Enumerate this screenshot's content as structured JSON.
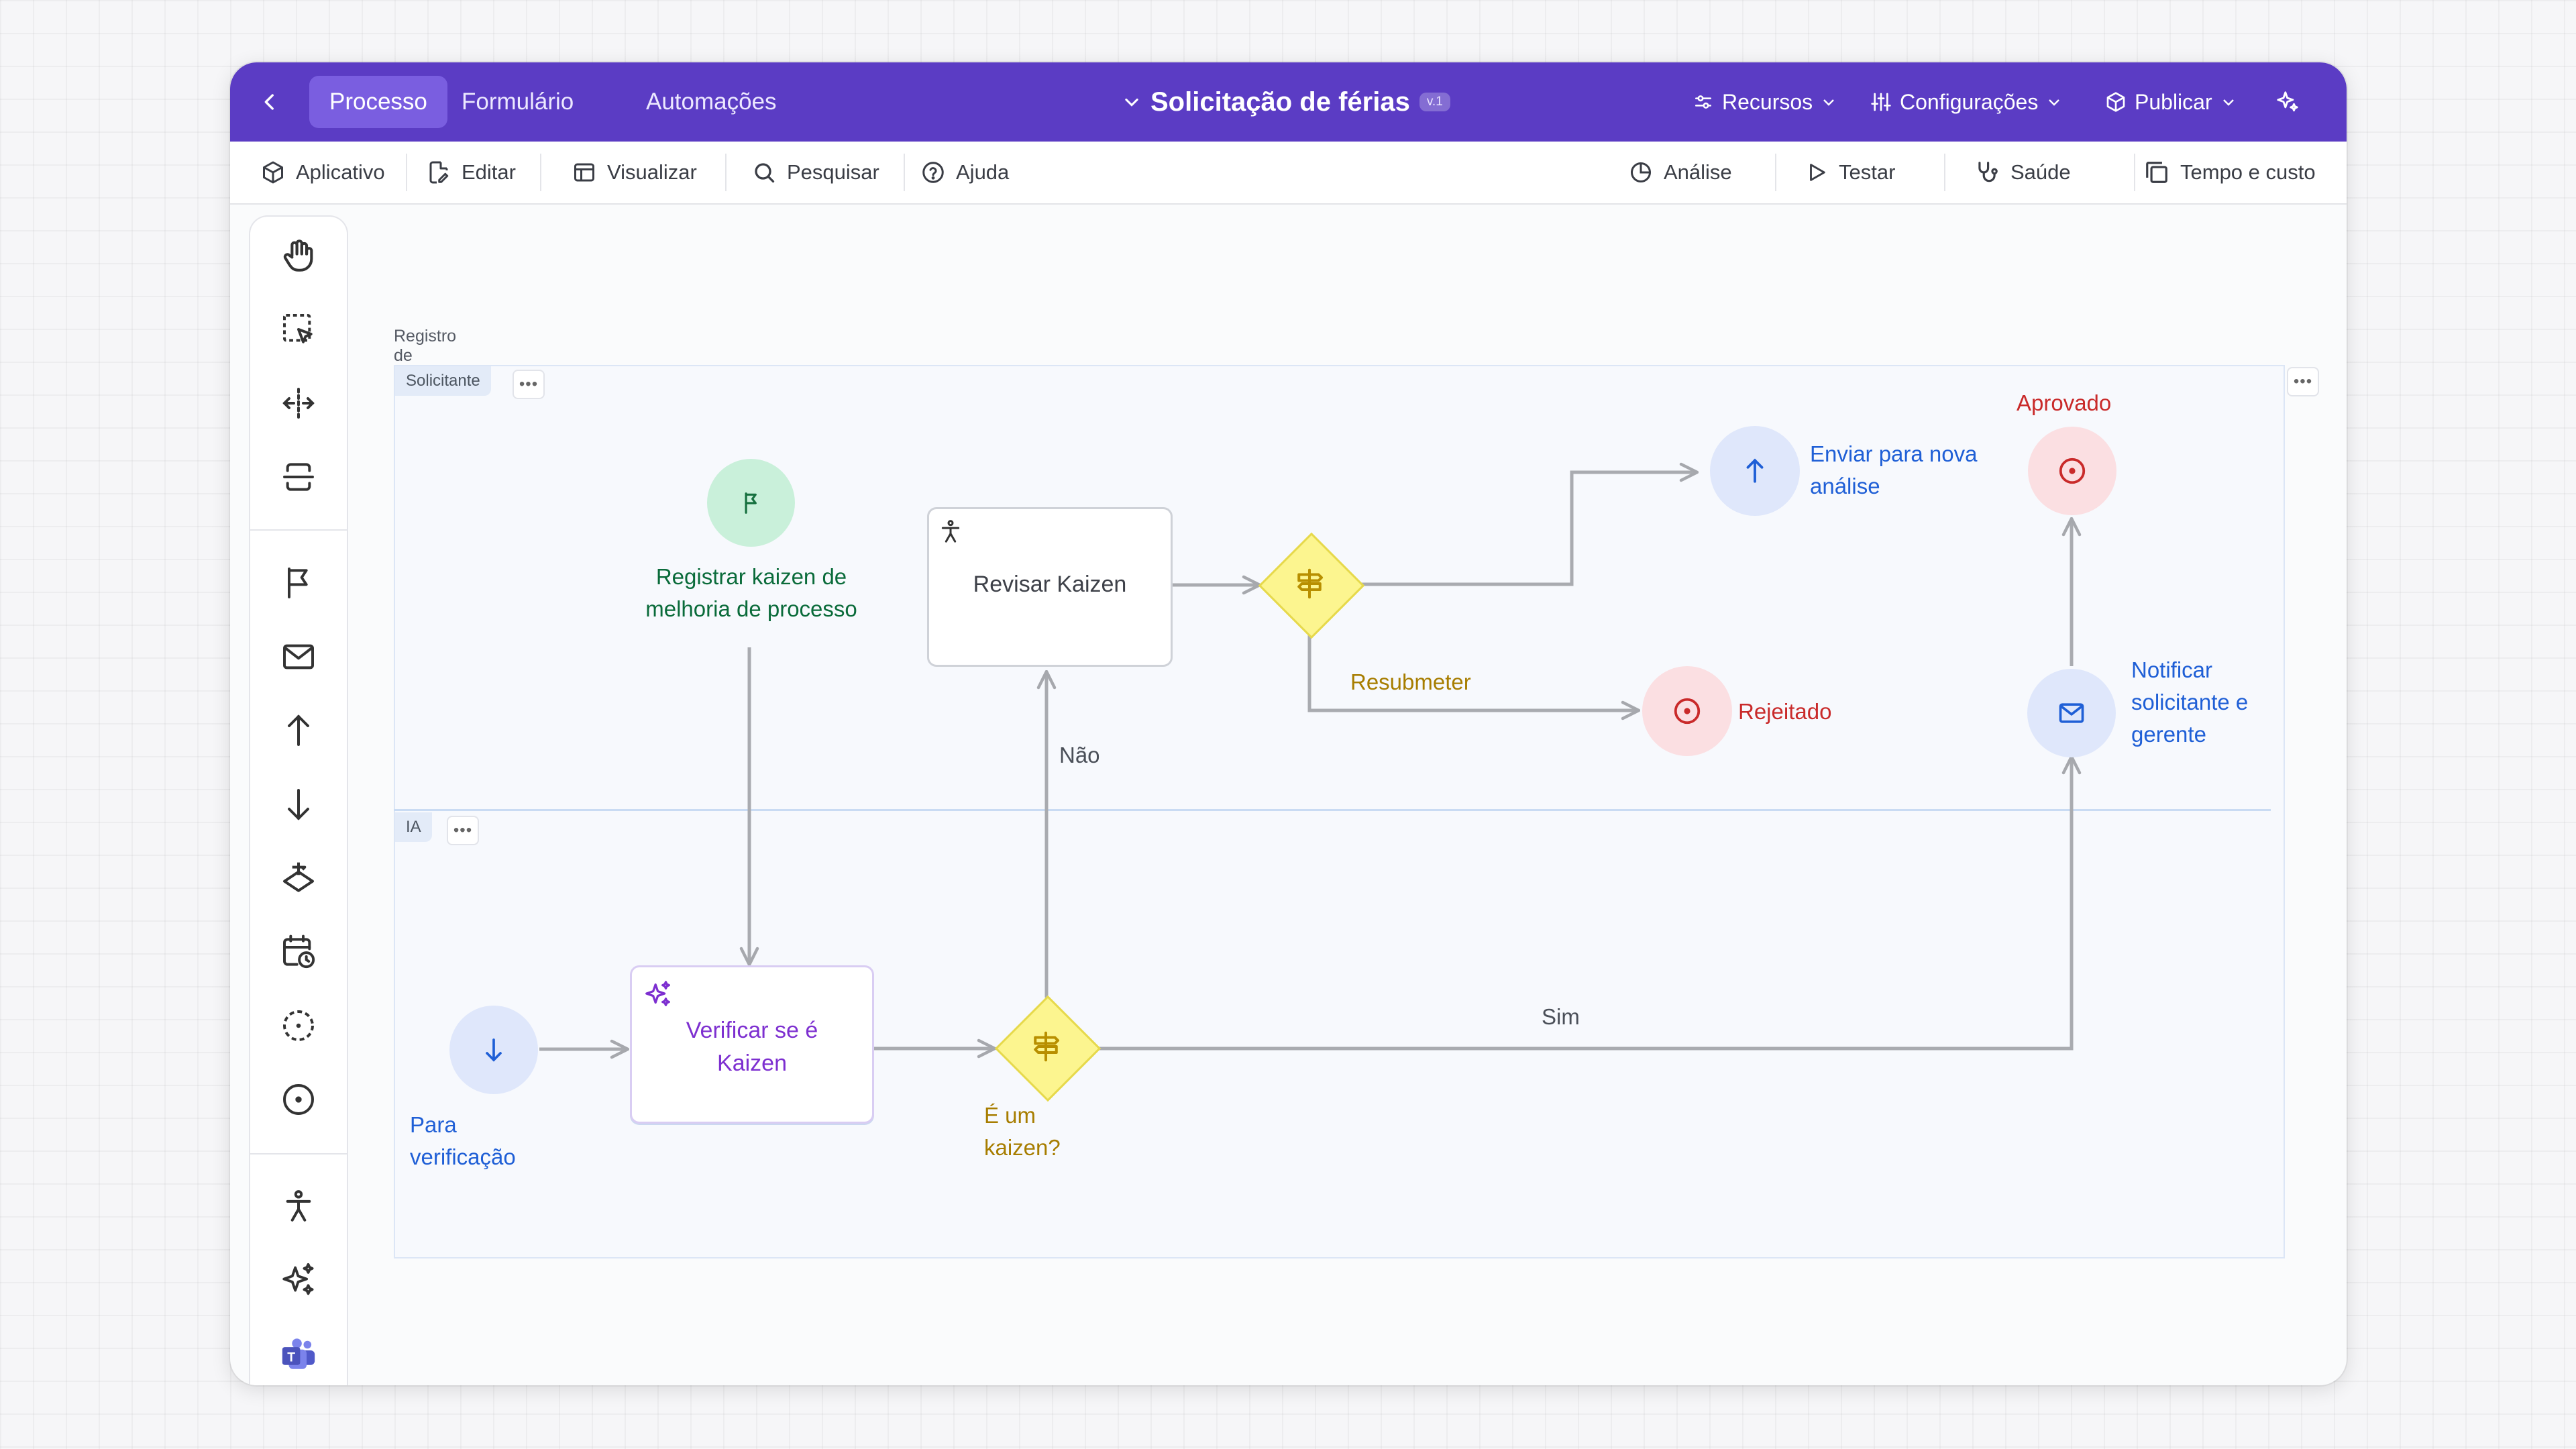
{
  "header": {
    "tabs": [
      {
        "label": "Processo",
        "active": true
      },
      {
        "label": "Formulário",
        "active": false
      },
      {
        "label": "Automações",
        "active": false
      }
    ],
    "title": "Solicitação de férias",
    "version": "v.1",
    "right_menu": {
      "resources": "Recursos",
      "settings": "Configurações",
      "publish": "Publicar"
    },
    "accent_color": "#5b3cc4"
  },
  "toolbar": {
    "left": [
      "Aplicativo",
      "Editar",
      "Visualizar",
      "Pesquisar",
      "Ajuda"
    ],
    "right": [
      "Análise",
      "Testar",
      "Saúde",
      "Tempo e custo"
    ]
  },
  "rail": {
    "icons": [
      "hand-icon",
      "select-area-icon",
      "move-horizontal-icon",
      "spacing-icon",
      "start-flag-icon",
      "mail-icon",
      "arrow-up-icon",
      "arrow-down-icon",
      "gateway-icon",
      "calendar-clock-icon",
      "dashed-circle-icon",
      "end-event-icon",
      "user-task-icon",
      "ai-sparkles-icon",
      "teams-icon"
    ]
  },
  "diagram": {
    "pool_title": "Registro de Kaizen",
    "lanes": [
      "Solicitante",
      "IA"
    ],
    "nodes": {
      "start": "Registrar kaizen de melhoria de processo",
      "review": "Revisar Kaizen",
      "resubmit_gateway": "Resubmeter",
      "send_back": "Enviar para nova análise",
      "rejected": "Rejeitado",
      "approved": "Aprovado",
      "notify": "Notificar solicitante e gerente",
      "for_verification": "Para verificação",
      "verify": "Verificar se é Kaizen",
      "is_kaizen": "É um kaizen?"
    },
    "edges": {
      "no": "Não",
      "yes": "Sim"
    },
    "colors": {
      "start": "#0a6b3a",
      "task_ai": "#7d2fd0",
      "message": "#1f5fd6",
      "end": "#c92a2a",
      "gateway": "#b78a00"
    }
  }
}
